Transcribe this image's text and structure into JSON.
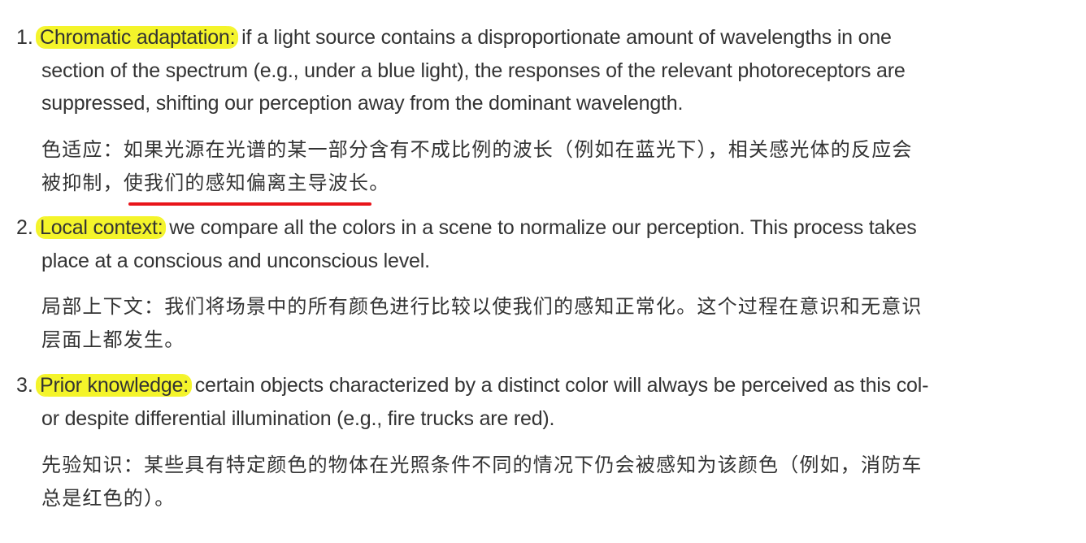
{
  "items": [
    {
      "number": "1.",
      "term": "Chromatic adaptation:",
      "en_line1_rest": " if a light source contains a disproportionate amount of wavelengths in one",
      "en_line2": "section of the spectrum (e.g., under a blue light), the responses of the relevant photoreceptors are",
      "en_line3": "suppressed, shifting our perception away from the dominant wavelength.",
      "zh_line1": "色适应：如果光源在光谱的某一部分含有不成比例的波长（例如在蓝光下），相关感光体的反应会",
      "zh_line2_pre": "被抑制，",
      "zh_line2_underlined": "使我们的感知偏离主导波长",
      "zh_line2_post": "。"
    },
    {
      "number": "2.",
      "term": "Local context:",
      "en_line1_rest": " we compare all the colors in a scene to normalize our perception. This process takes",
      "en_line2": "place at a conscious and unconscious level.",
      "zh_line1": "局部上下文：我们将场景中的所有颜色进行比较以使我们的感知正常化。这个过程在意识和无意识",
      "zh_line2": "层面上都发生。"
    },
    {
      "number": "3.",
      "term": "Prior knowledge:",
      "en_line1_rest": " certain objects characterized by a distinct color will always be perceived as this col-",
      "en_line2": "or despite differential illumination (e.g., fire trucks are red).",
      "zh_line1": "先验知识：某些具有特定颜色的物体在光照条件不同的情况下仍会被感知为该颜色（例如，消防车",
      "zh_line2": "总是红色的）。"
    }
  ],
  "colors": {
    "highlight": "#f4f42a",
    "underline": "#e8141a",
    "text": "#333333"
  }
}
